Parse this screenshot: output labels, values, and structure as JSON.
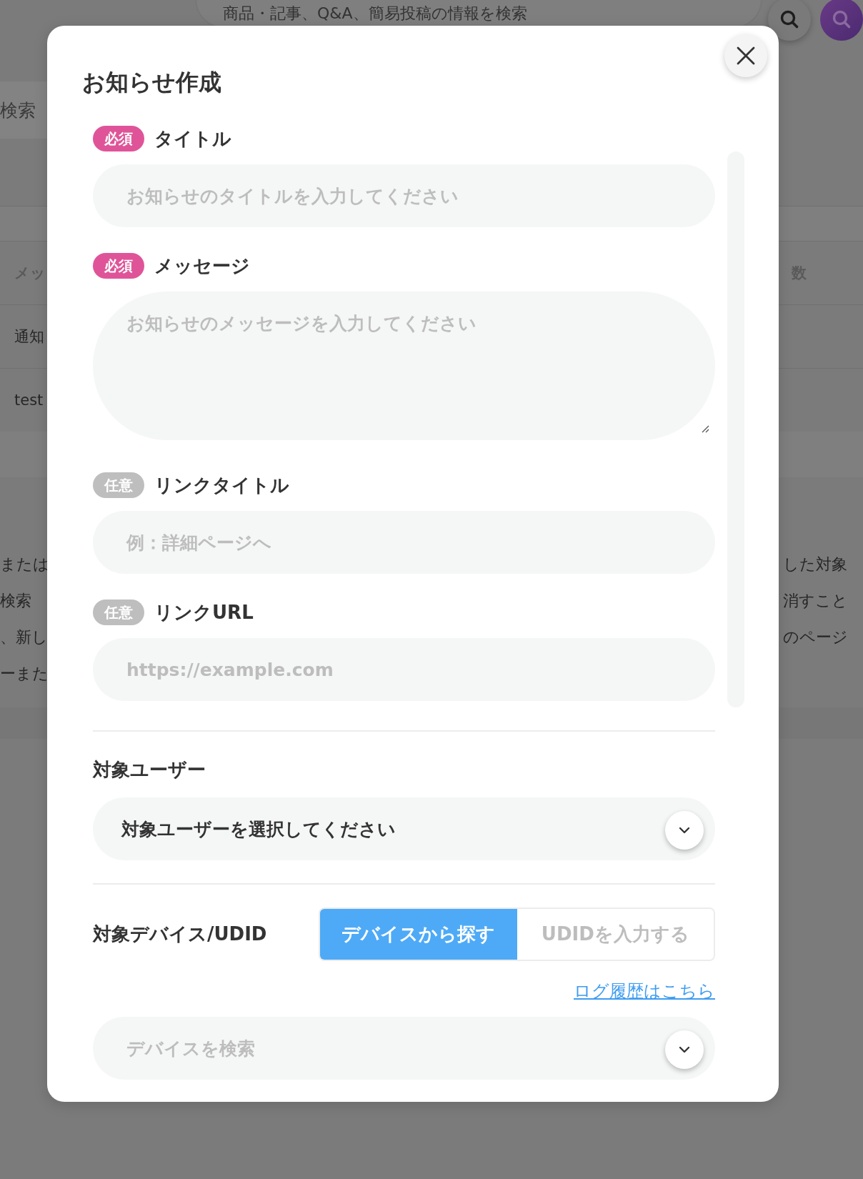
{
  "background": {
    "search_placeholder": "商品・記事、Q&A、簡易投稿の情報を検索",
    "tab": "検索",
    "table_header": {
      "column_1": "メッ",
      "column_2": "数"
    },
    "rows": [
      {
        "column_1": "通知"
      },
      {
        "column_1": "test"
      }
    ],
    "notes": [
      {
        "left": "または",
        "right": "した対象"
      },
      {
        "left": "検索",
        "right": "消すこと"
      },
      {
        "left": "、新し",
        "right": "のページ"
      },
      {
        "left": "ーまた"
      }
    ]
  },
  "modal": {
    "title": "お知らせ作成",
    "fields": [
      {
        "badge": "必須",
        "required": true,
        "label": "タイトル",
        "placeholder": "お知らせのタイトルを入力してください",
        "kind": "input"
      },
      {
        "badge": "必須",
        "required": true,
        "label": "メッセージ",
        "placeholder": "お知らせのメッセージを入力してください",
        "kind": "textarea"
      },
      {
        "badge": "任意",
        "required": false,
        "label": "リンクタイトル",
        "placeholder": "例：詳細ページへ",
        "kind": "input"
      },
      {
        "badge": "任意",
        "required": false,
        "label": "リンクURL",
        "placeholder": "https://example.com",
        "kind": "input"
      }
    ],
    "target_user": {
      "label": "対象ユーザー",
      "value": "対象ユーザーを選択してください"
    },
    "device": {
      "label": "対象デバイス/UDID",
      "options": [
        {
          "label": "デバイスから探す",
          "selected": true
        },
        {
          "label": "UDIDを入力する",
          "selected": false
        }
      ],
      "log_link": "ログ履歴はこちら",
      "search_placeholder": "デバイスを検索"
    }
  }
}
